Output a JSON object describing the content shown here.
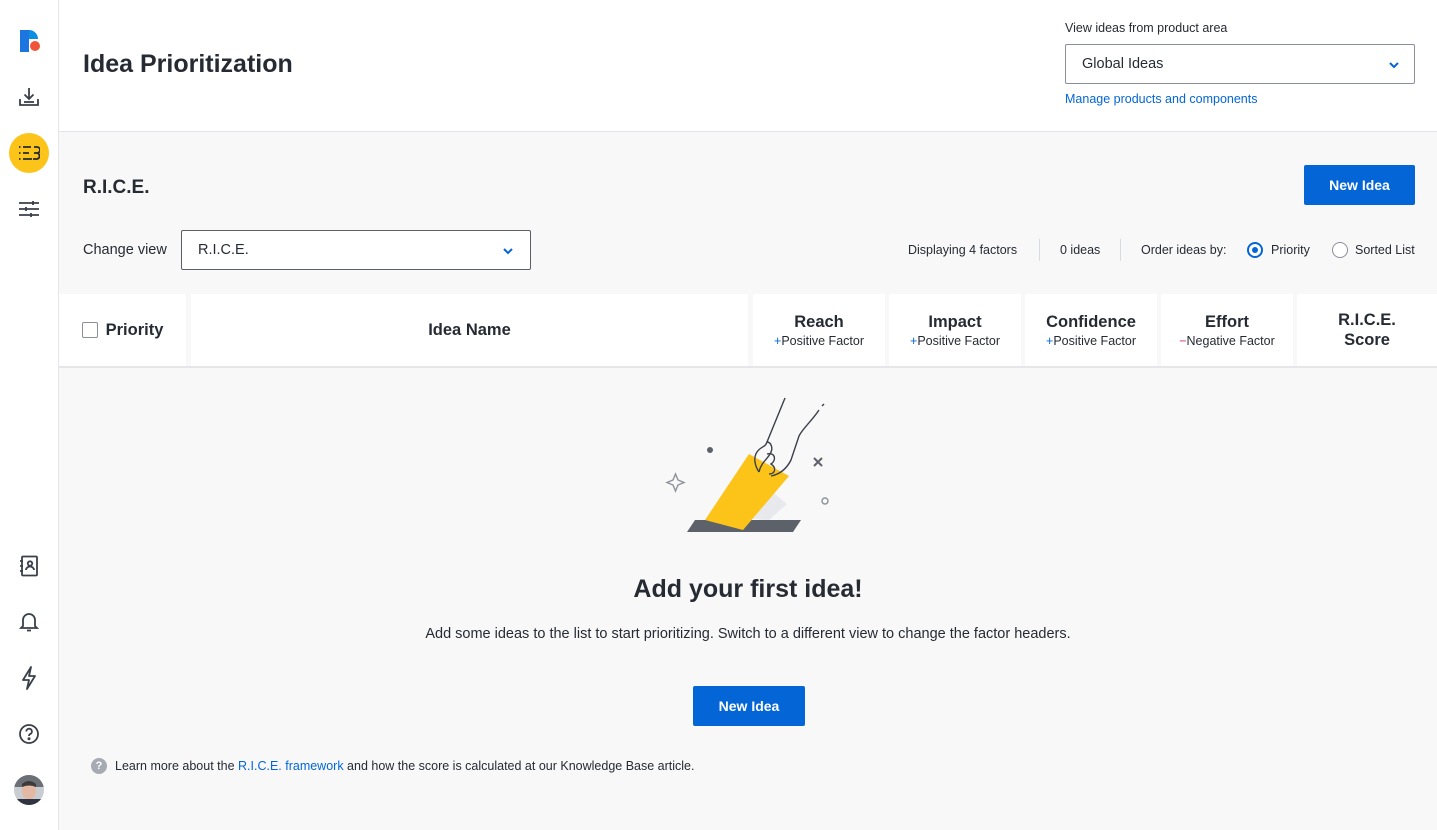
{
  "sidebar": {
    "items": [
      {
        "icon": "logo-icon"
      },
      {
        "icon": "inbox-download-icon"
      },
      {
        "icon": "prioritization-list-icon",
        "active": true
      },
      {
        "icon": "sliders-icon"
      },
      {
        "icon": "contacts-book-icon"
      },
      {
        "icon": "bell-icon"
      },
      {
        "icon": "lightning-icon"
      },
      {
        "icon": "help-icon"
      },
      {
        "icon": "avatar"
      }
    ],
    "active_color": "#fcc419"
  },
  "header": {
    "title": "Idea Prioritization",
    "product_area_label": "View ideas from product area",
    "product_area_value": "Global Ideas",
    "manage_link": "Manage products and components"
  },
  "main": {
    "section_title": "R.I.C.E.",
    "new_idea_label": "New Idea",
    "change_view_label": "Change view",
    "change_view_value": "R.I.C.E.",
    "displaying": "Displaying 4 factors",
    "idea_count": "0 ideas",
    "order_label": "Order ideas by:",
    "order_options": [
      {
        "label": "Priority",
        "selected": true
      },
      {
        "label": "Sorted List",
        "selected": false
      }
    ]
  },
  "table": {
    "columns": {
      "priority": "Priority",
      "idea_name": "Idea Name",
      "reach": {
        "label": "Reach",
        "sign": "+",
        "sub": "Positive Factor"
      },
      "impact": {
        "label": "Impact",
        "sign": "+",
        "sub": "Positive Factor"
      },
      "confidence": {
        "label": "Confidence",
        "sign": "+",
        "sub": "Positive Factor"
      },
      "effort": {
        "label": "Effort",
        "sign": "−",
        "sub": "Negative Factor"
      },
      "score": {
        "line1": "R.I.C.E.",
        "line2": "Score"
      }
    }
  },
  "empty_state": {
    "title": "Add your first idea!",
    "description": "Add some ideas to the list to start prioritizing. Switch to a different view to change the factor headers.",
    "button": "New Idea",
    "kb_prefix": "Learn more about the ",
    "kb_link": "R.I.C.E. framework",
    "kb_suffix": " and how the score is calculated at our Knowledge Base article."
  },
  "colors": {
    "primary": "#0466d6",
    "accent_yellow": "#fcc419",
    "negative": "#d6336c"
  }
}
